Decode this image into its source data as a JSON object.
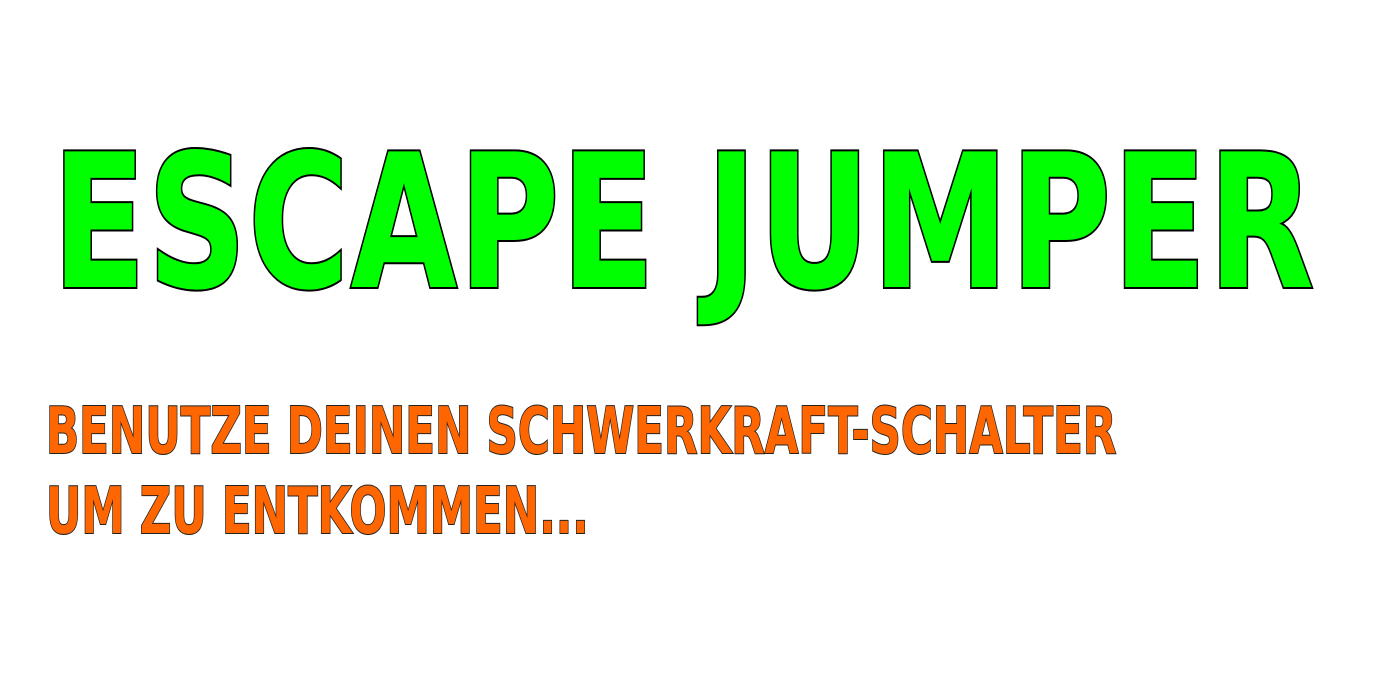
{
  "screen": {
    "title": "ESCAPE JUMPER",
    "subtitle_lines": [
      "BENUTZE DEINEN SCHWERKRAFT-SCHALTER",
      "UM ZU ENTKOMMEN..."
    ]
  },
  "colors": {
    "background": "#ffffff",
    "title_fill": "#00ff00",
    "title_outline": "#000000",
    "subtitle_fill": "#ff6600",
    "subtitle_outline": "#222222"
  }
}
